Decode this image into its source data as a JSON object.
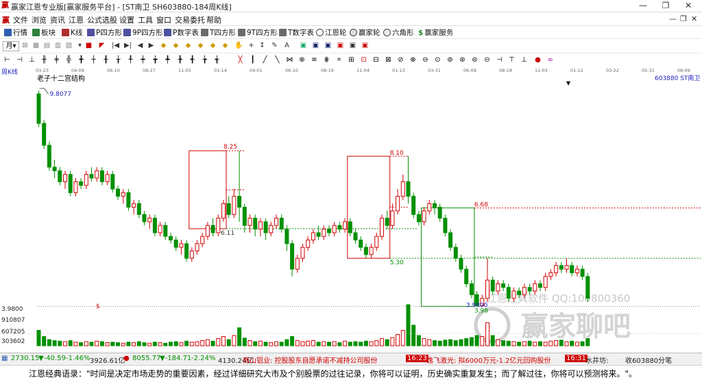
{
  "window": {
    "title": "赢家江恩专业版[赢家服务平台] - [ST南卫  SH603880-184周K线]",
    "minimize": "—",
    "maximize": "❐",
    "close": "✕"
  },
  "menu": {
    "items": [
      "文件",
      "浏览",
      "资讯",
      "江恩",
      "公式选股",
      "设置",
      "工具",
      "窗口",
      "交易委托",
      "帮助"
    ],
    "mdi_controls": [
      "—",
      "❐",
      "✕"
    ]
  },
  "toolbar1": {
    "items": [
      {
        "label": "行情",
        "icon": "grid-icon"
      },
      {
        "label": "板块",
        "icon": "blocks-icon"
      },
      {
        "label": "K线",
        "icon": "kline-icon"
      },
      {
        "label": "P四方形",
        "icon": "square-icon"
      },
      {
        "label": "9P四方形",
        "icon": "square-icon"
      },
      {
        "label": "P数字表",
        "icon": "table-icon"
      },
      {
        "label": "T四方形",
        "icon": "square-icon"
      },
      {
        "label": "9T四方形",
        "icon": "square-icon"
      },
      {
        "label": "T数字表",
        "icon": "table-icon"
      },
      {
        "label": "江恩轮",
        "icon": "wheel-icon"
      },
      {
        "label": "赢家轮",
        "icon": "wheel-icon"
      },
      {
        "label": "六角形",
        "icon": "hexagon-icon"
      },
      {
        "label": "赢家服务",
        "icon": "dollar-icon"
      }
    ]
  },
  "toolbar2": {
    "dropdown_value": "月"
  },
  "chart": {
    "period_label": "周K线",
    "structure_label": "老子十二宫结构",
    "top_marker": "▼",
    "stock_code_label": "603880  ST南卫",
    "price_axis_label": "3.9800",
    "dollar_marker": "$",
    "volume_axis": [
      "910807",
      "607205",
      "303602"
    ],
    "date_ticks": [
      "03-23",
      "04-09",
      "06-10",
      "08-27",
      "11-05",
      "01-14",
      "04-01",
      "06-10",
      "08-19",
      "11-04",
      "01-13",
      "03-31",
      "06-09",
      "08-18",
      "11-03",
      "01-12",
      "03-22",
      "05-31",
      "08-09"
    ],
    "annotations": {
      "high_first": "9.8077",
      "box1_top": "8.25",
      "box1_mid": "6.11",
      "box2_top": "8.10",
      "box2_bottom": "5.30",
      "box3_top": "6.68",
      "low_price": "3.98",
      "low_line": "3.9800"
    },
    "watermark": {
      "software": "江恩江具软件  QQ:100800360",
      "forum": "赢家聊吧"
    },
    "colors": {
      "up": "#d00000",
      "down": "#009000",
      "box_red": "#d00000",
      "box_green": "#009000",
      "price_text": "#2020c0"
    }
  },
  "chart_data": {
    "type": "candlestick",
    "series": [
      {
        "values": [
          [
            9.81,
            9.0,
            9.9,
            8.9
          ],
          [
            9.0,
            8.4,
            9.1,
            8.3
          ],
          [
            8.4,
            7.8,
            8.5,
            7.7
          ],
          [
            7.8,
            7.7,
            8.0,
            7.5
          ],
          [
            7.7,
            7.4,
            7.8,
            7.3
          ],
          [
            7.4,
            7.6,
            7.7,
            7.2
          ],
          [
            7.6,
            7.1,
            7.7,
            7.0
          ],
          [
            7.1,
            7.4,
            7.5,
            7.0
          ],
          [
            7.4,
            7.3,
            7.5,
            7.2
          ],
          [
            7.3,
            7.6,
            7.7,
            7.2
          ],
          [
            7.6,
            7.5,
            7.8,
            7.4
          ],
          [
            7.5,
            7.7,
            7.8,
            7.4
          ],
          [
            7.7,
            7.4,
            7.8,
            7.3
          ],
          [
            7.4,
            7.6,
            7.7,
            7.3
          ],
          [
            7.6,
            7.2,
            7.7,
            7.1
          ],
          [
            7.2,
            7.0,
            7.3,
            6.9
          ],
          [
            7.0,
            7.1,
            7.2,
            6.8
          ],
          [
            7.1,
            6.7,
            7.2,
            6.6
          ],
          [
            6.7,
            6.8,
            6.9,
            6.5
          ],
          [
            6.8,
            6.5,
            6.9,
            6.4
          ],
          [
            6.5,
            6.3,
            6.6,
            6.2
          ],
          [
            6.3,
            6.4,
            6.5,
            6.1
          ],
          [
            6.4,
            6.0,
            6.5,
            5.9
          ],
          [
            6.0,
            6.2,
            6.3,
            5.9
          ],
          [
            6.2,
            5.9,
            6.3,
            5.8
          ],
          [
            5.9,
            5.8,
            6.0,
            5.7
          ],
          [
            5.8,
            5.6,
            5.9,
            5.5
          ],
          [
            5.6,
            5.7,
            5.8,
            5.4
          ],
          [
            5.7,
            5.3,
            5.8,
            5.2
          ],
          [
            5.3,
            5.5,
            5.6,
            5.2
          ],
          [
            5.5,
            5.7,
            5.8,
            5.4
          ],
          [
            5.7,
            5.9,
            6.0,
            5.6
          ],
          [
            5.9,
            6.2,
            6.3,
            5.8
          ],
          [
            6.2,
            6.0,
            6.4,
            5.9
          ],
          [
            6.0,
            6.4,
            6.5,
            5.9
          ],
          [
            6.4,
            6.8,
            6.9,
            6.3
          ],
          [
            6.8,
            6.5,
            7.0,
            6.4
          ],
          [
            6.5,
            7.0,
            7.2,
            6.4
          ],
          [
            7.0,
            6.7,
            8.25,
            6.3
          ],
          [
            6.7,
            6.2,
            6.8,
            6.0
          ],
          [
            6.2,
            6.4,
            6.5,
            6.0
          ],
          [
            6.4,
            6.1,
            6.5,
            5.9
          ],
          [
            6.1,
            6.3,
            6.4,
            5.9
          ],
          [
            6.3,
            6.0,
            6.4,
            5.8
          ],
          [
            6.0,
            6.2,
            6.3,
            5.9
          ],
          [
            6.2,
            6.4,
            6.5,
            6.1
          ],
          [
            6.4,
            6.1,
            6.5,
            6.0
          ],
          [
            6.1,
            5.7,
            6.2,
            5.5
          ],
          [
            5.7,
            5.0,
            5.8,
            4.8
          ],
          [
            5.0,
            5.3,
            5.4,
            4.9
          ],
          [
            5.3,
            5.6,
            5.7,
            5.2
          ],
          [
            5.6,
            5.8,
            5.9,
            5.5
          ],
          [
            5.8,
            6.0,
            6.1,
            5.7
          ],
          [
            6.0,
            5.9,
            6.2,
            5.8
          ],
          [
            5.9,
            6.1,
            6.2,
            5.8
          ],
          [
            6.1,
            6.0,
            6.2,
            5.9
          ],
          [
            6.0,
            6.2,
            6.3,
            5.9
          ],
          [
            6.2,
            6.1,
            6.3,
            6.0
          ],
          [
            6.1,
            6.3,
            6.4,
            6.0
          ],
          [
            6.3,
            6.0,
            6.4,
            5.9
          ],
          [
            6.0,
            5.8,
            6.1,
            5.7
          ],
          [
            5.8,
            5.6,
            5.9,
            5.5
          ],
          [
            5.6,
            5.4,
            5.7,
            5.3
          ],
          [
            5.4,
            5.6,
            5.7,
            5.3
          ],
          [
            5.6,
            5.9,
            6.0,
            5.5
          ],
          [
            5.9,
            6.4,
            6.5,
            5.8
          ],
          [
            6.4,
            6.2,
            6.6,
            6.1
          ],
          [
            6.2,
            6.6,
            6.8,
            6.1
          ],
          [
            6.6,
            7.0,
            7.2,
            6.5
          ],
          [
            7.0,
            7.4,
            7.6,
            6.9
          ],
          [
            7.4,
            7.0,
            8.1,
            6.8
          ],
          [
            7.0,
            6.5,
            7.1,
            6.4
          ],
          [
            6.5,
            6.3,
            6.6,
            6.2
          ],
          [
            6.3,
            6.6,
            6.7,
            6.2
          ],
          [
            6.6,
            6.8,
            6.9,
            6.5
          ],
          [
            6.8,
            6.7,
            6.9,
            6.5
          ],
          [
            6.7,
            6.4,
            6.8,
            6.3
          ],
          [
            6.4,
            6.0,
            6.5,
            5.9
          ],
          [
            6.0,
            5.6,
            6.1,
            5.5
          ],
          [
            5.6,
            5.3,
            5.7,
            5.2
          ],
          [
            5.3,
            5.0,
            5.4,
            4.9
          ],
          [
            5.0,
            4.6,
            5.1,
            4.5
          ],
          [
            4.6,
            4.3,
            4.7,
            4.2
          ],
          [
            4.3,
            4.0,
            4.4,
            3.98
          ],
          [
            4.0,
            4.2,
            4.3,
            3.98
          ],
          [
            4.2,
            4.7,
            5.3,
            4.1
          ],
          [
            4.7,
            4.4,
            4.8,
            4.3
          ],
          [
            4.4,
            4.6,
            4.7,
            4.3
          ],
          [
            4.6,
            4.5,
            4.7,
            4.4
          ],
          [
            4.5,
            4.2,
            4.6,
            4.1
          ],
          [
            4.2,
            4.4,
            4.5,
            4.1
          ],
          [
            4.4,
            4.3,
            4.5,
            4.2
          ],
          [
            4.3,
            4.5,
            4.6,
            4.2
          ],
          [
            4.5,
            4.4,
            4.6,
            4.3
          ],
          [
            4.4,
            4.6,
            4.7,
            4.3
          ],
          [
            4.6,
            4.5,
            4.7,
            4.4
          ],
          [
            4.5,
            4.8,
            4.9,
            4.4
          ],
          [
            4.8,
            4.9,
            5.0,
            4.7
          ],
          [
            4.9,
            5.1,
            5.2,
            4.8
          ],
          [
            5.1,
            5.0,
            5.2,
            4.9
          ],
          [
            5.0,
            5.1,
            5.3,
            4.9
          ],
          [
            5.1,
            4.9,
            5.2,
            4.8
          ],
          [
            4.9,
            5.0,
            5.1,
            4.8
          ],
          [
            5.0,
            4.8,
            5.1,
            4.7
          ],
          [
            4.8,
            4.2,
            4.9,
            4.1
          ]
        ]
      }
    ],
    "value_order": [
      "open",
      "close",
      "high",
      "low"
    ],
    "volume": [
      30,
      18,
      12,
      10,
      9,
      8,
      10,
      7,
      6,
      8,
      7,
      9,
      8,
      6,
      7,
      6,
      5,
      7,
      6,
      8,
      6,
      5,
      7,
      6,
      5,
      7,
      8,
      6,
      9,
      7,
      8,
      10,
      12,
      9,
      14,
      18,
      12,
      20,
      35,
      15,
      10,
      8,
      9,
      7,
      6,
      8,
      7,
      12,
      18,
      10,
      8,
      9,
      10,
      7,
      8,
      7,
      8,
      6,
      9,
      7,
      8,
      7,
      9,
      8,
      10,
      14,
      12,
      16,
      22,
      30,
      80,
      40,
      20,
      14,
      12,
      10,
      9,
      11,
      12,
      10,
      12,
      14,
      16,
      20,
      18,
      45,
      20,
      12,
      10,
      9,
      8,
      7,
      8,
      9,
      7,
      8,
      7,
      9,
      10,
      11,
      8,
      9,
      7,
      8,
      14
    ]
  },
  "status": {
    "sh_index": "2730.15",
    "sh_change": "▼-40.59",
    "sh_pct": "-1.46%",
    "sh_amount": "3926.61亿",
    "sz_index": "8055.77",
    "sz_change": "▼-184.71",
    "sz_pct": "-2.24%",
    "sz_amount": "4130.24亿",
    "news1": "南山铝业:  控股股东自愿承诺不减持公司股份",
    "time1": "16:23",
    "news2": "逸飞激光:  拟6000万元-1.2亿元回购股份",
    "time2": "16:31",
    "news3": "水井坊:",
    "right_text": "收603880分笔"
  },
  "quote": {
    "text": "江恩经典语录：\"时间是决定市场走势的重要因素，经过详细研究大市及个别股票的过往记录，你将可以证明，历史确实重复发生；而了解过往，你将可以预测将来。\"。"
  }
}
